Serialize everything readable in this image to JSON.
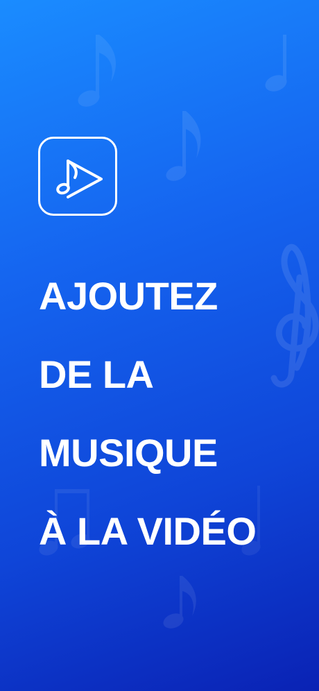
{
  "app_icon": {
    "name": "play-music-icon"
  },
  "headline": {
    "lines": [
      "AJOUTEZ",
      "DE LA",
      "MUSIQUE",
      "À LA VIDÉO"
    ]
  },
  "colors": {
    "gradient_top": "#1a8cff",
    "gradient_bottom": "#0a22b4",
    "text": "#ffffff"
  }
}
